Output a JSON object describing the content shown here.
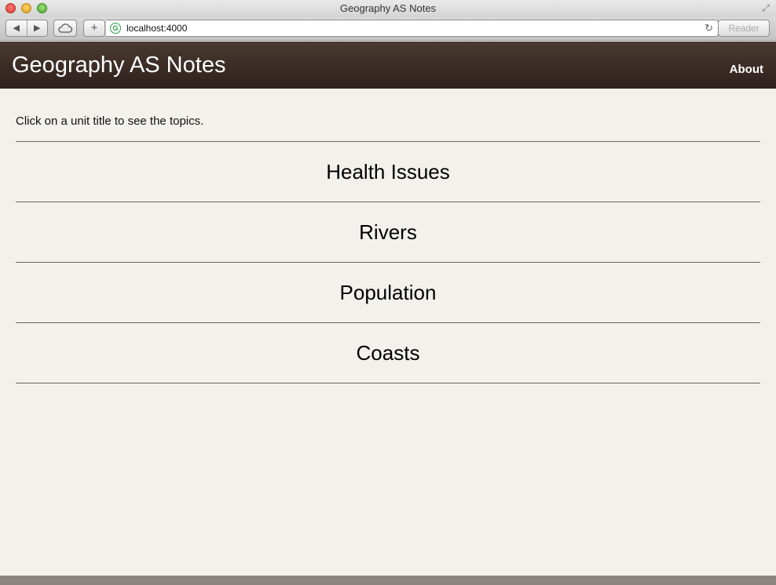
{
  "window": {
    "title": "Geography AS Notes"
  },
  "toolbar": {
    "url": "localhost:4000",
    "reader_label": "Reader",
    "site_icon_letter": "G"
  },
  "header": {
    "title": "Geography AS Notes",
    "about_label": "About"
  },
  "main": {
    "intro": "Click on a unit title to see the topics.",
    "units": [
      {
        "label": "Health Issues"
      },
      {
        "label": "Rivers"
      },
      {
        "label": "Population"
      },
      {
        "label": "Coasts"
      }
    ]
  },
  "colors": {
    "header": "#3a2b25",
    "background": "#f2f1ec",
    "footer": "#8a8480"
  }
}
